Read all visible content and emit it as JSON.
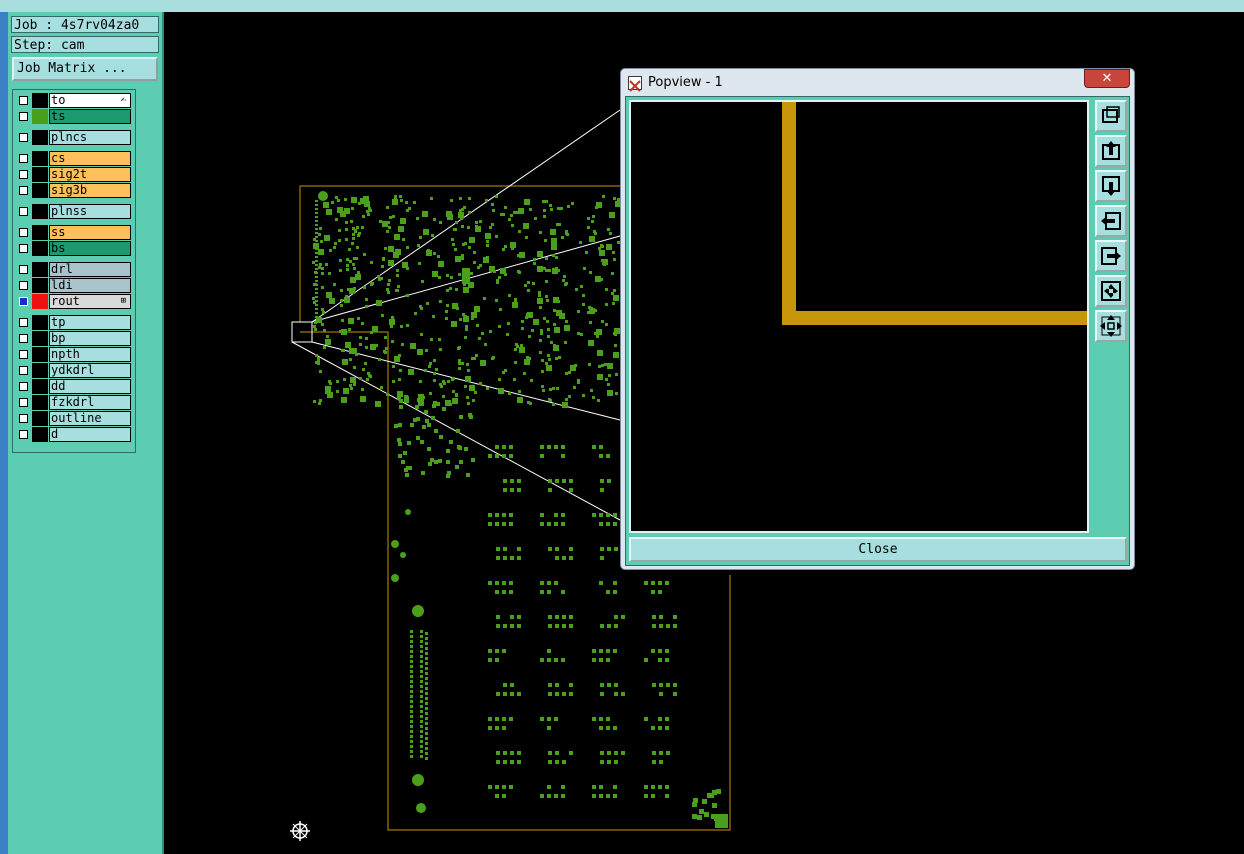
{
  "app": {
    "job_label": "Job : 4s7rv04za0",
    "step_label": "Step: cam",
    "job_matrix_button": "Job Matrix ..."
  },
  "layers": [
    {
      "name": "to",
      "color": "#ffffff",
      "swatch": "#000000",
      "marker": "✍"
    },
    {
      "name": "ts",
      "color": "#1a9a6e",
      "swatch": "#4aa01a",
      "marker": ""
    },
    {
      "name": "plncs",
      "color": "#a7dfe0",
      "swatch": "#000000",
      "marker": ""
    },
    {
      "name": "cs",
      "color": "#ffc05c",
      "swatch": "#000000",
      "marker": ""
    },
    {
      "name": "sig2t",
      "color": "#ffc05c",
      "swatch": "#000000",
      "marker": ""
    },
    {
      "name": "sig3b",
      "color": "#ffc05c",
      "swatch": "#000000",
      "marker": ""
    },
    {
      "name": "plnss",
      "color": "#a7dfe0",
      "swatch": "#000000",
      "marker": ""
    },
    {
      "name": "ss",
      "color": "#ffc05c",
      "swatch": "#000000",
      "marker": ""
    },
    {
      "name": "bs",
      "color": "#1a9a6e",
      "swatch": "#000000",
      "marker": ""
    },
    {
      "name": "drl",
      "color": "#a9c3cb",
      "swatch": "#000000",
      "marker": ""
    },
    {
      "name": "ldi",
      "color": "#a9c3cb",
      "swatch": "#000000",
      "marker": ""
    },
    {
      "name": "rout",
      "color": "#d9d9d9",
      "swatch": "#ee1111",
      "marker": "⊞"
    },
    {
      "name": "tp",
      "color": "#a7dfe0",
      "swatch": "#000000",
      "marker": ""
    },
    {
      "name": "bp",
      "color": "#a7dfe0",
      "swatch": "#000000",
      "marker": ""
    },
    {
      "name": "npth",
      "color": "#a7dfe0",
      "swatch": "#000000",
      "marker": ""
    },
    {
      "name": "ydkdrl",
      "color": "#a7dfe0",
      "swatch": "#000000",
      "marker": ""
    },
    {
      "name": "dd",
      "color": "#a7dfe0",
      "swatch": "#000000",
      "marker": ""
    },
    {
      "name": "fzkdrl",
      "color": "#a7dfe0",
      "swatch": "#000000",
      "marker": ""
    },
    {
      "name": "outline",
      "color": "#a7dfe0",
      "swatch": "#000000",
      "marker": ""
    },
    {
      "name": "d",
      "color": "#a7dfe0",
      "swatch": "#000000",
      "marker": ""
    }
  ],
  "popview": {
    "title": "Popview - 1",
    "close_x": "✕",
    "close_button": "Close",
    "tools": [
      "zoom-home-icon",
      "pan-up-icon",
      "pan-down-icon",
      "pan-left-icon",
      "pan-right-icon",
      "zoom-fit-icon",
      "zoom-out-icon"
    ]
  },
  "colors": {
    "panel": "#5ccdb1",
    "pcb_feature": "#4aa01a",
    "trace": "#c8960a",
    "outline": "#c8960a"
  }
}
